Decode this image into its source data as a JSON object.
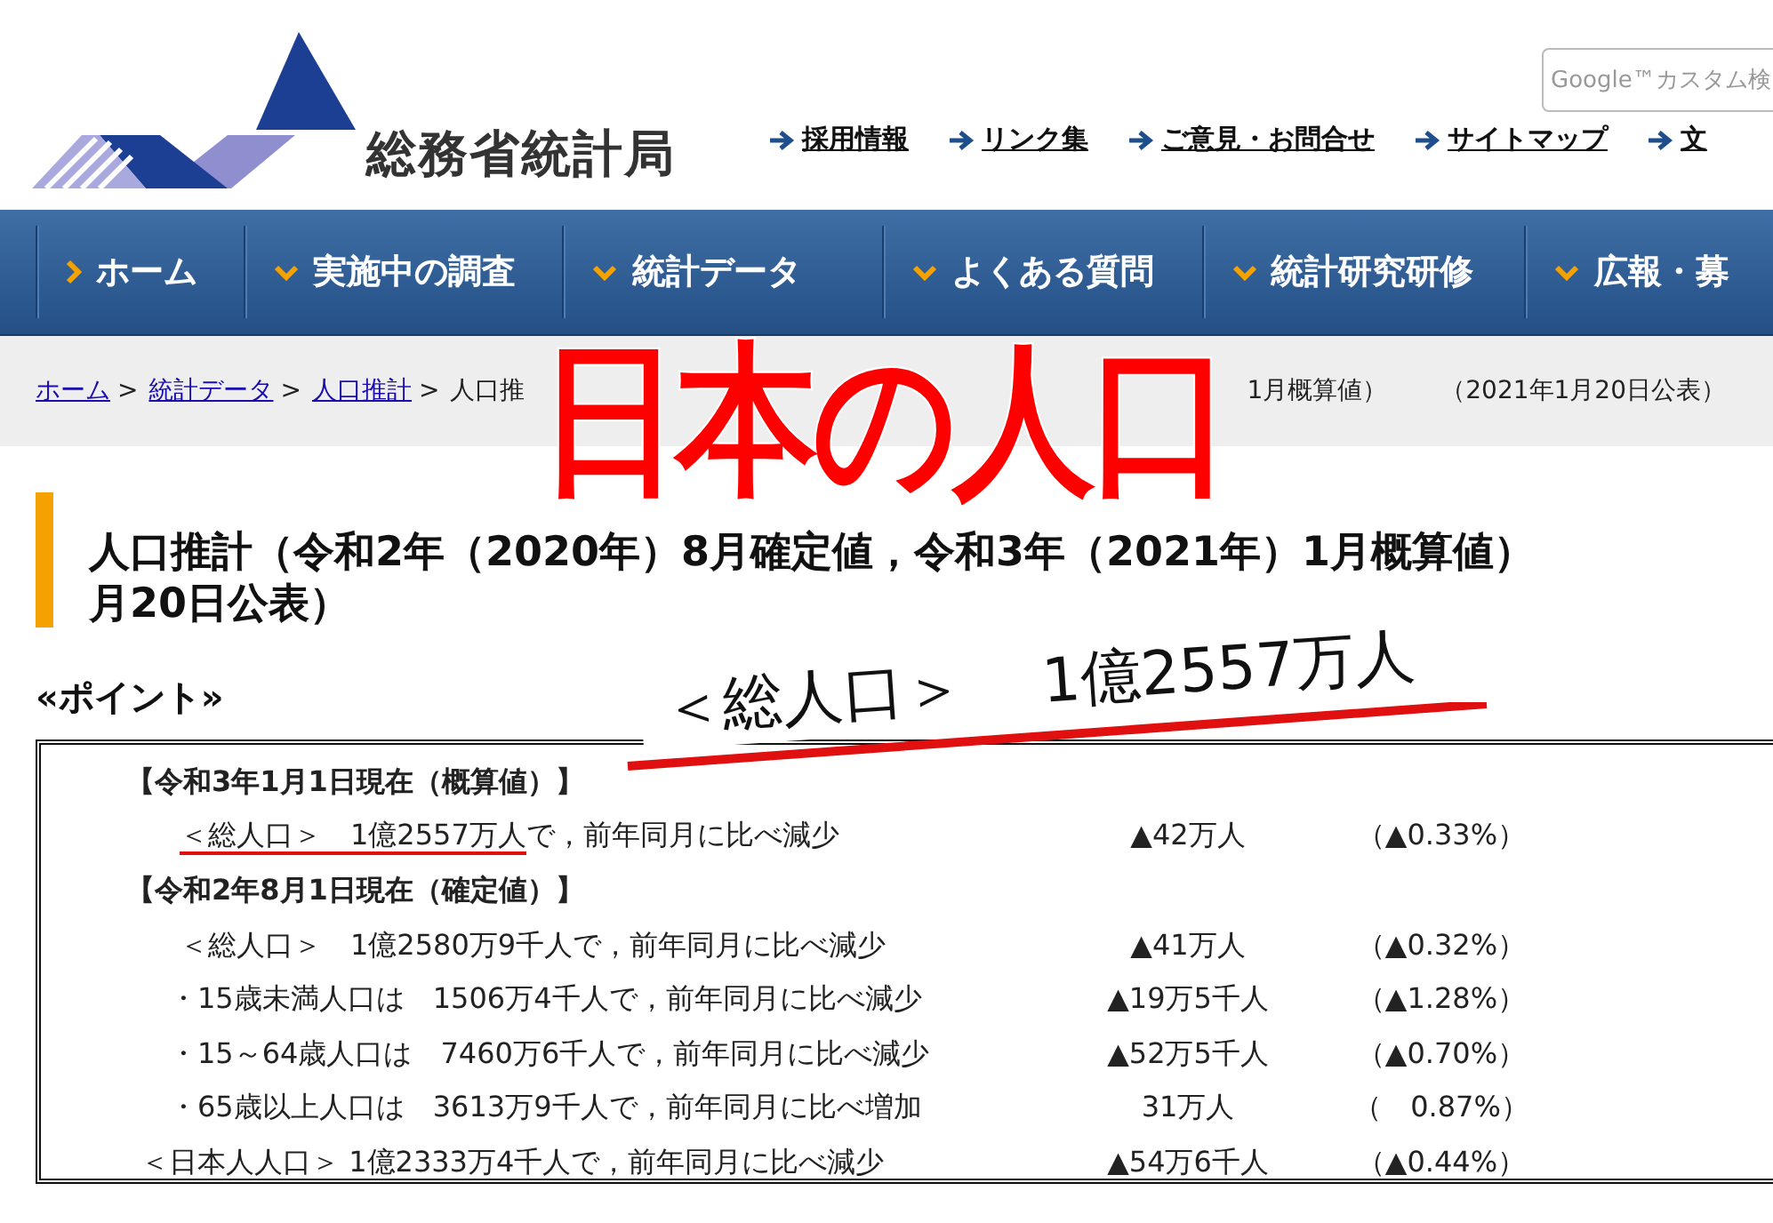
{
  "header": {
    "logo_text": "総務省統計局",
    "search": {
      "placeholder": "Google™カスタム検"
    },
    "links": [
      "採用情報",
      "リンク集",
      "ご意見・お問合せ",
      "サイトマップ",
      "文"
    ]
  },
  "nav": [
    {
      "kind": "home",
      "label": "ホーム"
    },
    {
      "kind": "menu",
      "label": "実施中の調査"
    },
    {
      "kind": "menu",
      "label": "統計データ"
    },
    {
      "kind": "menu",
      "label": "よくある質問"
    },
    {
      "kind": "menu",
      "label": "統計研究研修"
    },
    {
      "kind": "menu",
      "label": "広報・募"
    }
  ],
  "breadcrumb": {
    "links": [
      "ホーム",
      "統計データ",
      "人口推計"
    ],
    "separator": ">",
    "fragments": [
      "人口推",
      "1月概算値）"
    ],
    "date": "（2021年1月20日公表）"
  },
  "overlay_title": "日本の人口",
  "annotation": {
    "label": "＜総人口＞",
    "value": "1億2557万人"
  },
  "page_title": [
    "人口推計（令和2年（2020年）8月確定値，令和3年（2021年）1月概算値）",
    "月20日公表）"
  ],
  "point_heading": "«ポイント»",
  "summary": [
    {
      "kind": "section",
      "subject": "【令和3年1月1日現在（概算値）】"
    },
    {
      "kind": "total",
      "subject": "＜総人口＞　1億2557万人",
      "predicate": "で，前年同月に比べ減少",
      "change": "▲42万人",
      "rate": "（▲0.33%）",
      "underlined": true
    },
    {
      "kind": "section",
      "subject": "【令和2年8月1日現在（確定値）】"
    },
    {
      "kind": "total",
      "subject": "＜総人口＞　1億2580万9千人",
      "predicate": "で，前年同月に比べ減少",
      "change": "▲41万人",
      "rate": "（▲0.32%）",
      "underlined": false
    },
    {
      "kind": "age",
      "subject": "・15歳未満人口は　1506万4千人",
      "predicate": "で，前年同月に比べ減少",
      "change": "▲19万5千人",
      "rate": "（▲1.28%）",
      "underlined": false
    },
    {
      "kind": "age",
      "subject": "・15～64歳人口は　7460万6千人",
      "predicate": "で，前年同月に比べ減少",
      "change": "▲52万5千人",
      "rate": "（▲0.70%）",
      "underlined": false
    },
    {
      "kind": "age",
      "subject": "・65歳以上人口は　3613万9千人",
      "predicate": "で，前年同月に比べ増加",
      "change": "31万人",
      "rate": "（　0.87%）",
      "underlined": false
    },
    {
      "kind": "japanese",
      "subject": "＜日本人人口＞ 1億2333万4千人",
      "predicate": "で，前年同月に比べ減少",
      "change": "▲54万6千人",
      "rate": "（▲0.44%）",
      "underlined": false
    }
  ]
}
